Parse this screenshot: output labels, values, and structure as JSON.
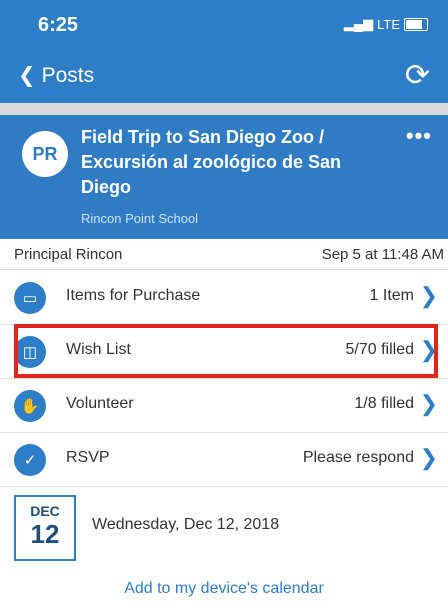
{
  "status": {
    "time": "6:25",
    "network": "LTE"
  },
  "nav": {
    "back_label": "Posts"
  },
  "post": {
    "avatar_initials": "PR",
    "title": "Field Trip to San Diego Zoo  /  Excursión al zoológico de San Diego",
    "school": "Rincon Point School",
    "author": "Principal Rincon",
    "date": "Sep 5 at 11:48 AM"
  },
  "items": [
    {
      "label": "Items for Purchase",
      "value": "1 Item",
      "icon": "card-icon"
    },
    {
      "label": "Wish List",
      "value": "5/70 filled",
      "icon": "basket-icon"
    },
    {
      "label": "Volunteer",
      "value": "1/8 filled",
      "icon": "hand-icon"
    },
    {
      "label": "RSVP",
      "value": "Please respond",
      "icon": "calendar-check-icon"
    }
  ],
  "event": {
    "month": "DEC",
    "day": "12",
    "date_text": "Wednesday, Dec 12, 2018"
  },
  "calendar_link": "Add to my device's calendar",
  "colors": {
    "primary": "#2d7ec7",
    "highlight": "#e3261b"
  }
}
